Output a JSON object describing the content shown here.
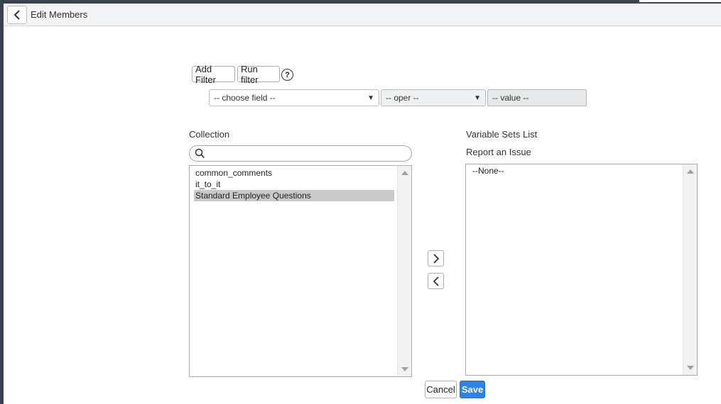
{
  "header": {
    "title": "Edit Members",
    "back_icon": "chevron-left-icon"
  },
  "filter": {
    "add_filter_label": "Add Filter",
    "run_filter_label": "Run filter",
    "help_glyph": "?",
    "field_select": "-- choose field --",
    "oper_select": "-- oper --",
    "value_placeholder": "-- value --"
  },
  "collection": {
    "label": "Collection",
    "search_value": "",
    "items": [
      {
        "label": "common_comments",
        "selected": false
      },
      {
        "label": "it_to_it",
        "selected": false
      },
      {
        "label": "Standard Employee Questions",
        "selected": true
      }
    ]
  },
  "variable_sets": {
    "label": "Variable Sets List",
    "sublabel": "Report an Issue",
    "items": [
      {
        "label": "--None--",
        "selected": false
      }
    ]
  },
  "actions": {
    "cancel_label": "Cancel",
    "save_label": "Save"
  },
  "colors": {
    "save_button": "#2f83e8",
    "selected_row": "#c8c9ca",
    "header_bg": "#f2f3f4"
  }
}
